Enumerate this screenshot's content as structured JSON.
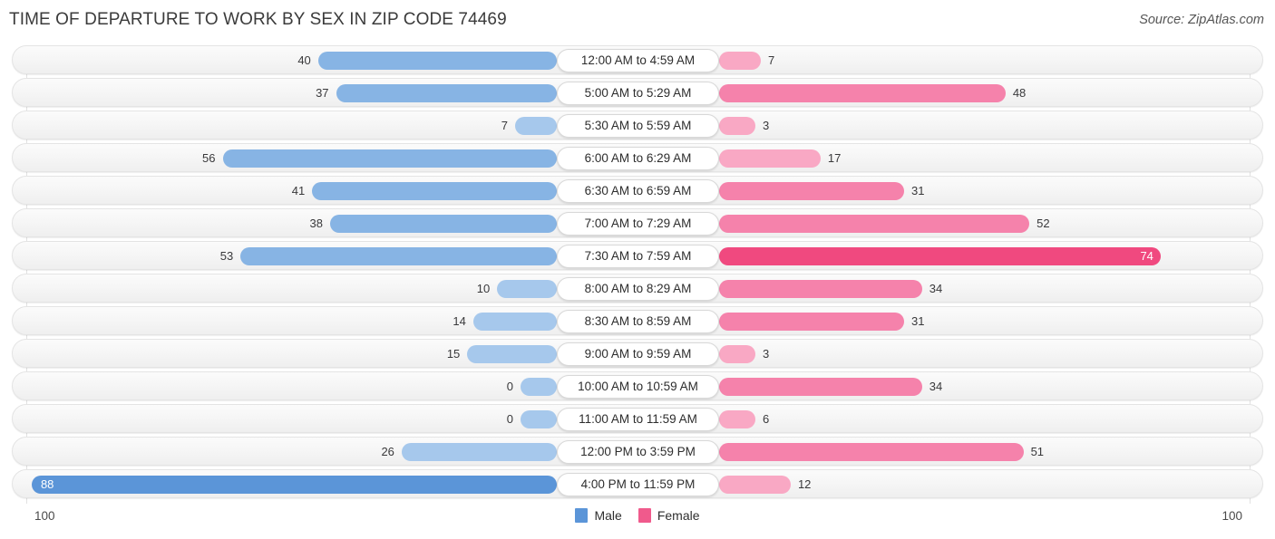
{
  "header": {
    "title": "TIME OF DEPARTURE TO WORK BY SEX IN ZIP CODE 74469",
    "source": "Source: ZipAtlas.com"
  },
  "axis": {
    "left_max_label": "100",
    "right_max_label": "100"
  },
  "legend": {
    "items": [
      {
        "label": "Male",
        "color": "#5b95d8"
      },
      {
        "label": "Female",
        "color": "#f05a8c"
      }
    ]
  },
  "colors": {
    "male_light": "#a6c8ec",
    "male_mid": "#87b4e4",
    "male_dark": "#5b95d8",
    "female_light": "#f9a8c4",
    "female_mid": "#f582ab",
    "female_dark": "#f0497f",
    "track": "#f4f4f4",
    "text": "#39393b"
  },
  "chart_data": {
    "type": "bar",
    "orientation": "horizontal",
    "style": "diverging-bidirectional",
    "title": "TIME OF DEPARTURE TO WORK BY SEX IN ZIP CODE 74469",
    "xlabel": "",
    "ylabel": "",
    "xlim": [
      100,
      100
    ],
    "grid": false,
    "legend_position": "bottom-center",
    "categories": [
      "12:00 AM to 4:59 AM",
      "5:00 AM to 5:29 AM",
      "5:30 AM to 5:59 AM",
      "6:00 AM to 6:29 AM",
      "6:30 AM to 6:59 AM",
      "7:00 AM to 7:29 AM",
      "7:30 AM to 7:59 AM",
      "8:00 AM to 8:29 AM",
      "8:30 AM to 8:59 AM",
      "9:00 AM to 9:59 AM",
      "10:00 AM to 10:59 AM",
      "11:00 AM to 11:59 AM",
      "12:00 PM to 3:59 PM",
      "4:00 PM to 11:59 PM"
    ],
    "series": [
      {
        "name": "Male",
        "color": "#5b95d8",
        "values": [
          40,
          37,
          7,
          56,
          41,
          38,
          53,
          10,
          14,
          15,
          0,
          0,
          26,
          88
        ]
      },
      {
        "name": "Female",
        "color": "#f05a8c",
        "values": [
          7,
          48,
          3,
          17,
          31,
          52,
          74,
          34,
          31,
          3,
          34,
          6,
          51,
          12
        ]
      }
    ]
  },
  "rows": [
    {
      "label": "12:00 AM to 4:59 AM",
      "male": "40",
      "female": "7",
      "male_inside": false,
      "female_inside": false
    },
    {
      "label": "5:00 AM to 5:29 AM",
      "male": "37",
      "female": "48",
      "male_inside": false,
      "female_inside": false
    },
    {
      "label": "5:30 AM to 5:59 AM",
      "male": "7",
      "female": "3",
      "male_inside": false,
      "female_inside": false
    },
    {
      "label": "6:00 AM to 6:29 AM",
      "male": "56",
      "female": "17",
      "male_inside": false,
      "female_inside": false
    },
    {
      "label": "6:30 AM to 6:59 AM",
      "male": "41",
      "female": "31",
      "male_inside": false,
      "female_inside": false
    },
    {
      "label": "7:00 AM to 7:29 AM",
      "male": "38",
      "female": "52",
      "male_inside": false,
      "female_inside": false
    },
    {
      "label": "7:30 AM to 7:59 AM",
      "male": "53",
      "female": "74",
      "male_inside": false,
      "female_inside": true
    },
    {
      "label": "8:00 AM to 8:29 AM",
      "male": "10",
      "female": "34",
      "male_inside": false,
      "female_inside": false
    },
    {
      "label": "8:30 AM to 8:59 AM",
      "male": "14",
      "female": "31",
      "male_inside": false,
      "female_inside": false
    },
    {
      "label": "9:00 AM to 9:59 AM",
      "male": "15",
      "female": "3",
      "male_inside": false,
      "female_inside": false
    },
    {
      "label": "10:00 AM to 10:59 AM",
      "male": "0",
      "female": "34",
      "male_inside": false,
      "female_inside": false
    },
    {
      "label": "11:00 AM to 11:59 AM",
      "male": "0",
      "female": "6",
      "male_inside": false,
      "female_inside": false
    },
    {
      "label": "12:00 PM to 3:59 PM",
      "male": "26",
      "female": "51",
      "male_inside": false,
      "female_inside": false
    },
    {
      "label": "4:00 PM to 11:59 PM",
      "male": "88",
      "female": "12",
      "male_inside": true,
      "female_inside": false
    }
  ]
}
